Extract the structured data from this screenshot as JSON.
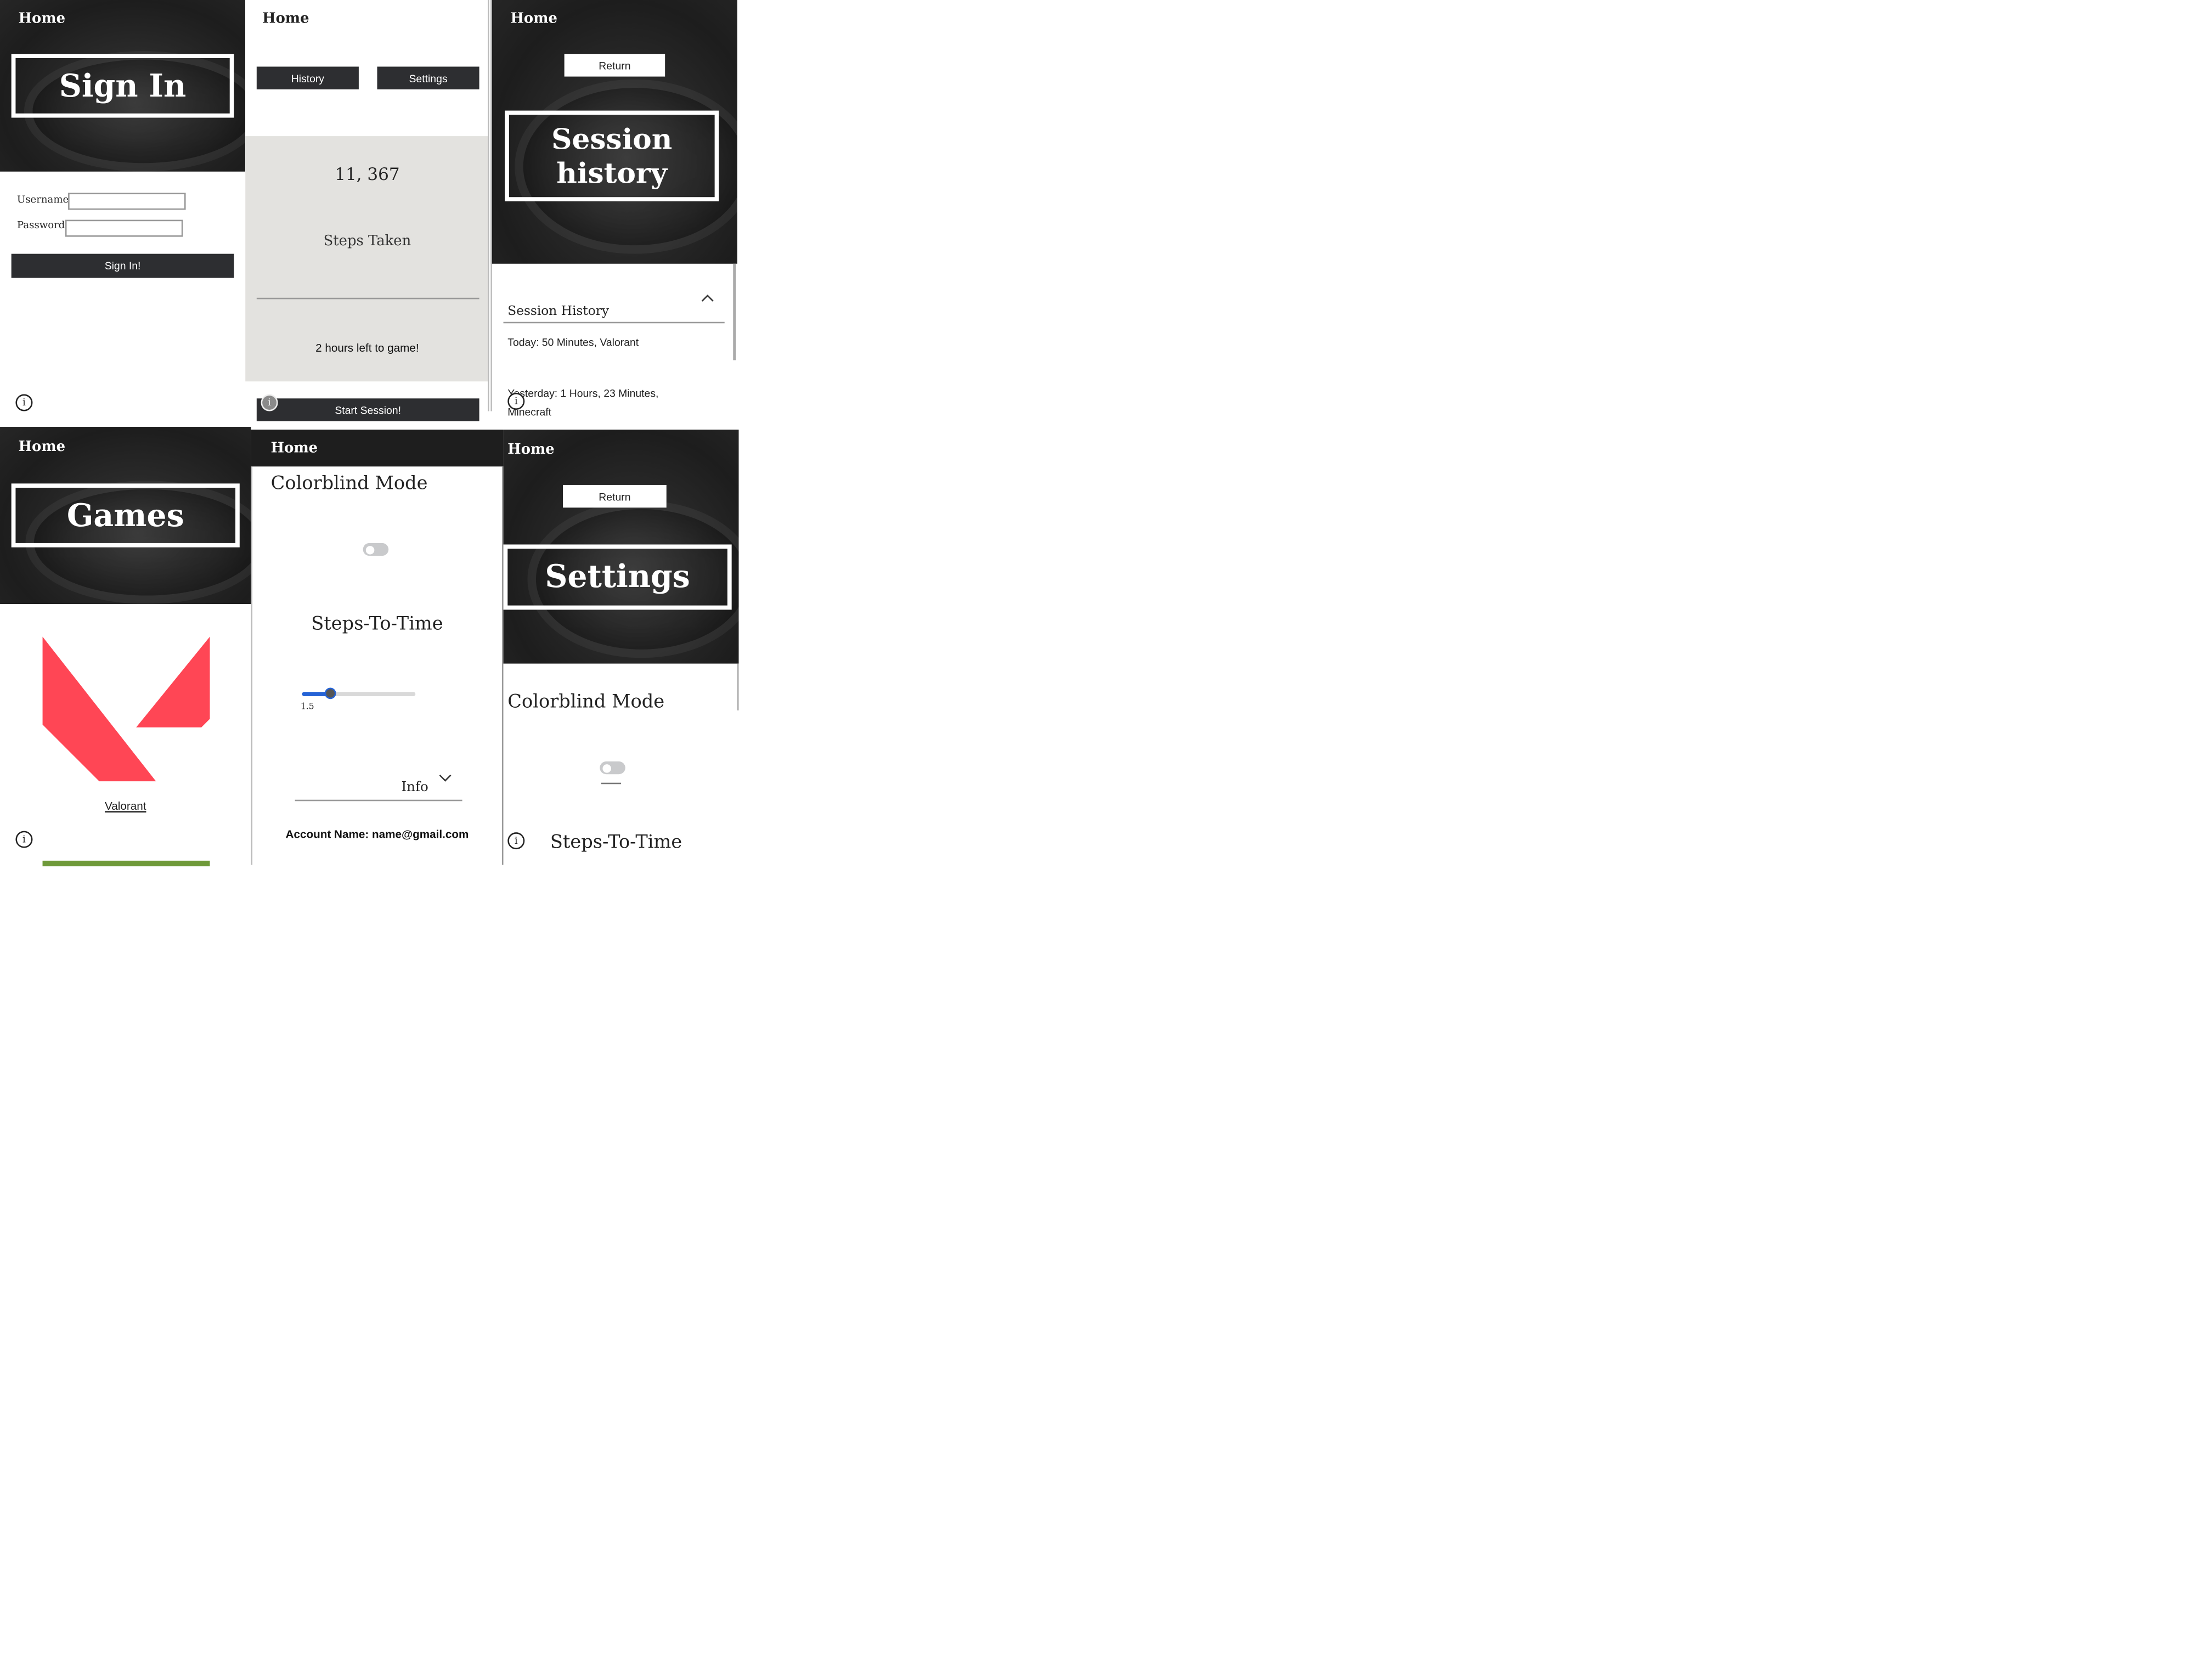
{
  "signin": {
    "home": "Home",
    "title": "Sign In",
    "username_label": "Username:",
    "password_label": "Password:",
    "username_value": "",
    "password_value": "",
    "submit_label": "Sign In!",
    "info_glyph": "i"
  },
  "dashboard": {
    "home": "Home",
    "history_label": "History",
    "settings_label": "Settings",
    "steps_value": "11, 367",
    "steps_caption": "Steps Taken",
    "time_left": "2 hours left to game!",
    "start_label": "Start Session!",
    "info_glyph": "i"
  },
  "history": {
    "home": "Home",
    "return_label": "Return",
    "title": "Session history",
    "accordion_label": "Session History",
    "entries": [
      "Today: 50 Minutes, Valorant",
      "Yesterday: 1 Hours, 23 Minutes, Minecraft"
    ],
    "info_glyph": "i"
  },
  "games": {
    "home": "Home",
    "title": "Games",
    "game_name": "Valorant",
    "logo_color": "#ff4655",
    "next_thumb_color": "#6f9a3a",
    "info_glyph": "i"
  },
  "settings_body": {
    "home": "Home",
    "colorblind_label": "Colorblind Mode",
    "steps_to_time_label": "Steps-To-Time",
    "slider_value": "1.5",
    "slider_fraction": 0.25,
    "info_label": "Info",
    "account_label": "Account Name: name@gmail.com"
  },
  "settings": {
    "home": "Home",
    "return_label": "Return",
    "title": "Settings",
    "colorblind_label": "Colorblind Mode",
    "steps_to_time_label": "Steps-To-Time",
    "info_glyph": "i"
  },
  "colors": {
    "dark_button": "#2d2e31",
    "panel_grey": "#e3e2df",
    "slider_blue": "#2563d6"
  }
}
